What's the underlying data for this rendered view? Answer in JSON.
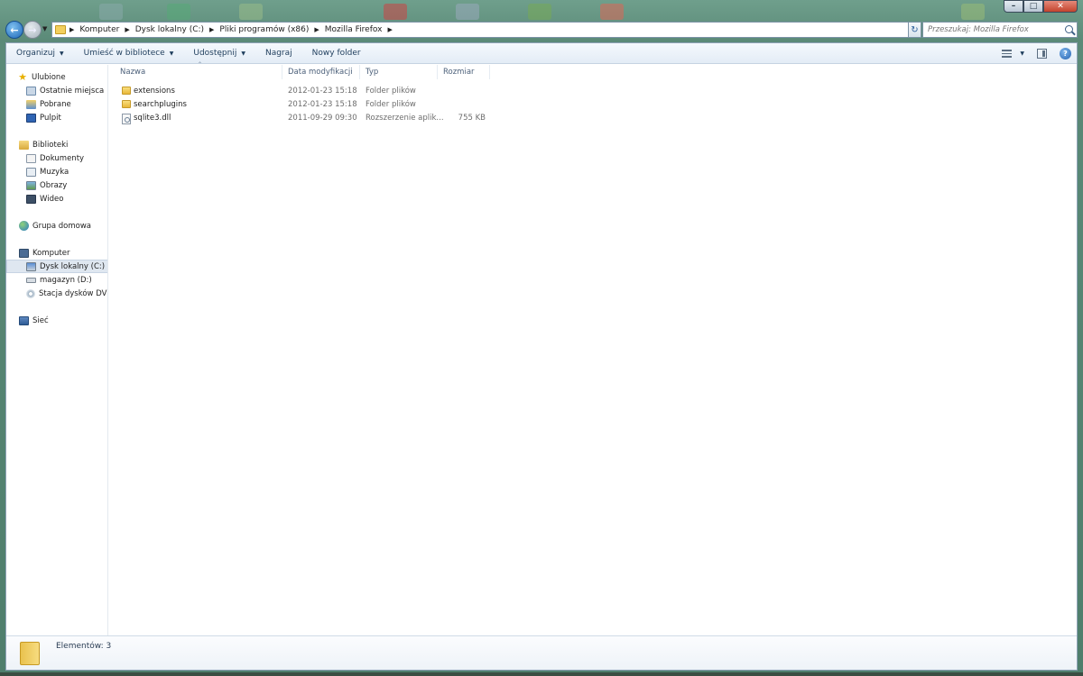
{
  "window": {
    "caption": {
      "minimize": "–",
      "maximize": "□",
      "close": "✕"
    }
  },
  "nav": {
    "back_glyph": "←",
    "forward_glyph": "→",
    "history_glyph": "▼",
    "refresh_glyph": "↻",
    "breadcrumbs": [
      "Komputer",
      "Dysk lokalny (C:)",
      "Pliki programów (x86)",
      "Mozilla Firefox"
    ],
    "separator": "▶",
    "search_placeholder": "Przeszukaj: Mozilla Firefox"
  },
  "toolbar": {
    "organize": "Organizuj",
    "include_in_library": "Umieść w bibliotece",
    "share": "Udostępnij",
    "burn": "Nagraj",
    "new_folder": "Nowy folder",
    "dropdown_glyph": "▼",
    "help_glyph": "?"
  },
  "sidebar": {
    "favorites": {
      "label": "Ulubione",
      "items": [
        "Ostatnie miejsca",
        "Pobrane",
        "Pulpit"
      ]
    },
    "libraries": {
      "label": "Biblioteki",
      "items": [
        "Dokumenty",
        "Muzyka",
        "Obrazy",
        "Wideo"
      ]
    },
    "homegroup": {
      "label": "Grupa domowa"
    },
    "computer": {
      "label": "Komputer",
      "items": [
        "Dysk lokalny (C:)",
        "magazyn (D:)",
        "Stacja dysków DVD R"
      ]
    },
    "network": {
      "label": "Sieć"
    }
  },
  "columns": {
    "name": "Nazwa",
    "date": "Data modyfikacji",
    "type": "Typ",
    "size": "Rozmiar"
  },
  "files": [
    {
      "name": "extensions",
      "date": "2012-01-23 15:18",
      "type": "Folder plików",
      "size": ""
    },
    {
      "name": "searchplugins",
      "date": "2012-01-23 15:18",
      "type": "Folder plików",
      "size": ""
    },
    {
      "name": "sqlite3.dll",
      "date": "2011-09-29 09:30",
      "type": "Rozszerzenie aplik...",
      "size": "755 KB"
    }
  ],
  "details": {
    "count_text": "Elementów: 3"
  },
  "colors": {
    "selection": "#dfe7f0",
    "toolbar_text": "#1e3d5c",
    "header_text": "#4c607a"
  }
}
